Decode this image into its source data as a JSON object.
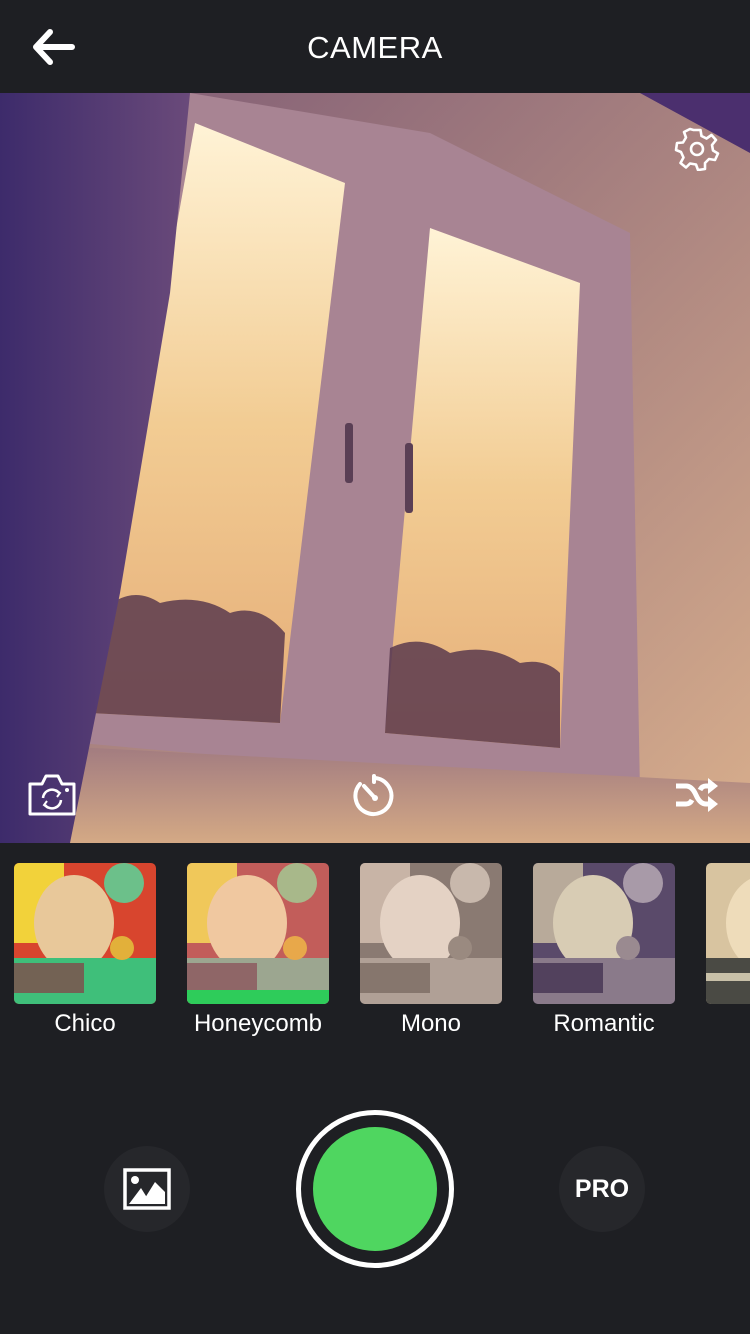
{
  "header": {
    "title": "CAMERA",
    "back_icon": "arrow-left-icon"
  },
  "preview": {
    "settings_icon": "gear-icon",
    "flip_camera_icon": "camera-flip-icon",
    "timer_icon": "timer-icon",
    "shuffle_icon": "shuffle-icon"
  },
  "filters": {
    "selected": "Honeycomb",
    "items": [
      {
        "label": "Chico",
        "selected": false
      },
      {
        "label": "Honeycomb",
        "selected": true
      },
      {
        "label": "Mono",
        "selected": false
      },
      {
        "label": "Romantic",
        "selected": false
      },
      {
        "label": "",
        "selected": false
      }
    ]
  },
  "controls": {
    "gallery_icon": "image-icon",
    "pro_label": "PRO"
  },
  "colors": {
    "background": "#1e1f23",
    "accent": "#4fd660",
    "selected_bar": "#2ecc5a"
  }
}
